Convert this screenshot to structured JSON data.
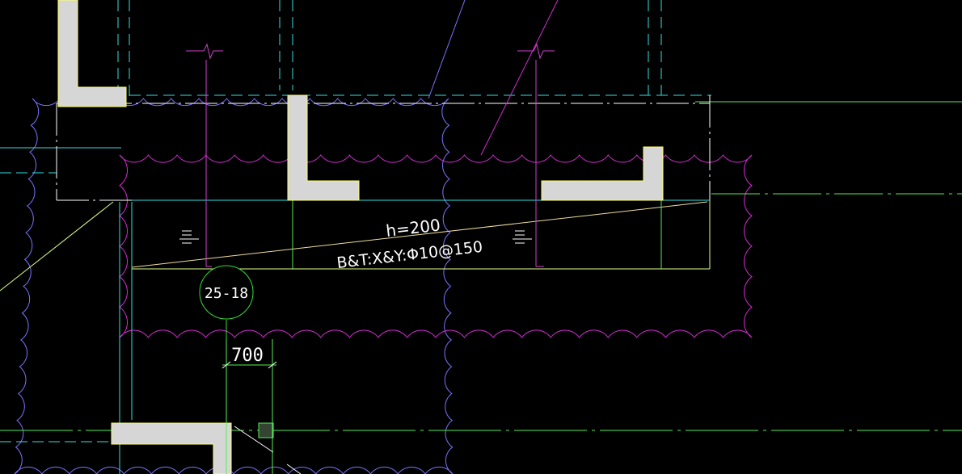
{
  "drawing": {
    "background": "#000000",
    "slab_annotation": {
      "thickness": "h=200",
      "reinforcement": "B&T:X&Y:Φ10@150"
    },
    "detail_callout": {
      "label": "25-18"
    },
    "dimension": {
      "value": "700"
    },
    "colors": {
      "cloud_magenta": "#d32bd3",
      "cloud_purple": "#7b73ff",
      "wall_fill": "#d6d6d6",
      "wall_edge": "#ffff66",
      "callout": "#33dd33",
      "dashed_cyan": "#33e0e0",
      "slab_outline": "#ddff88",
      "axis_green": "#55ee55",
      "leader": "#d040d0"
    }
  }
}
